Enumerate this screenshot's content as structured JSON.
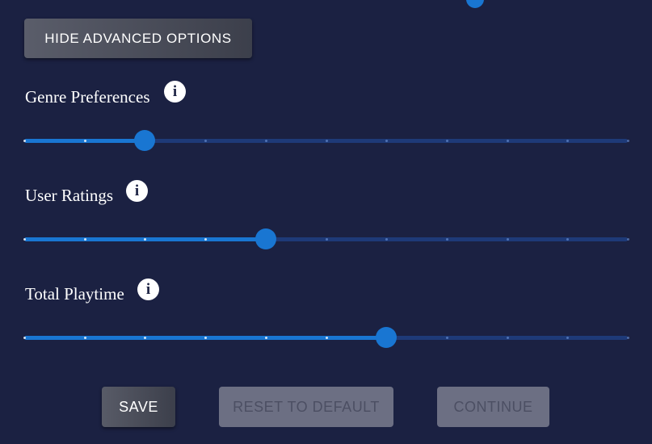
{
  "advanced_toggle": {
    "label": "HIDE ADVANCED OPTIONS"
  },
  "sliders": [
    {
      "label": "Genre Preferences",
      "icon": "info-icon",
      "value_fraction": 0.2,
      "steps": 10
    },
    {
      "label": "User Ratings",
      "icon": "info-icon",
      "value_fraction": 0.4,
      "steps": 10
    },
    {
      "label": "Total Playtime",
      "icon": "info-icon",
      "value_fraction": 0.6,
      "steps": 10
    }
  ],
  "actions": {
    "save_label": "SAVE",
    "reset_label": "RESET TO DEFAULT",
    "continue_label": "CONTINUE"
  },
  "colors": {
    "background": "#1b2142",
    "accent": "#1976d2",
    "track_inactive": "#1e3a78",
    "disabled_button": "#6c6f83"
  }
}
